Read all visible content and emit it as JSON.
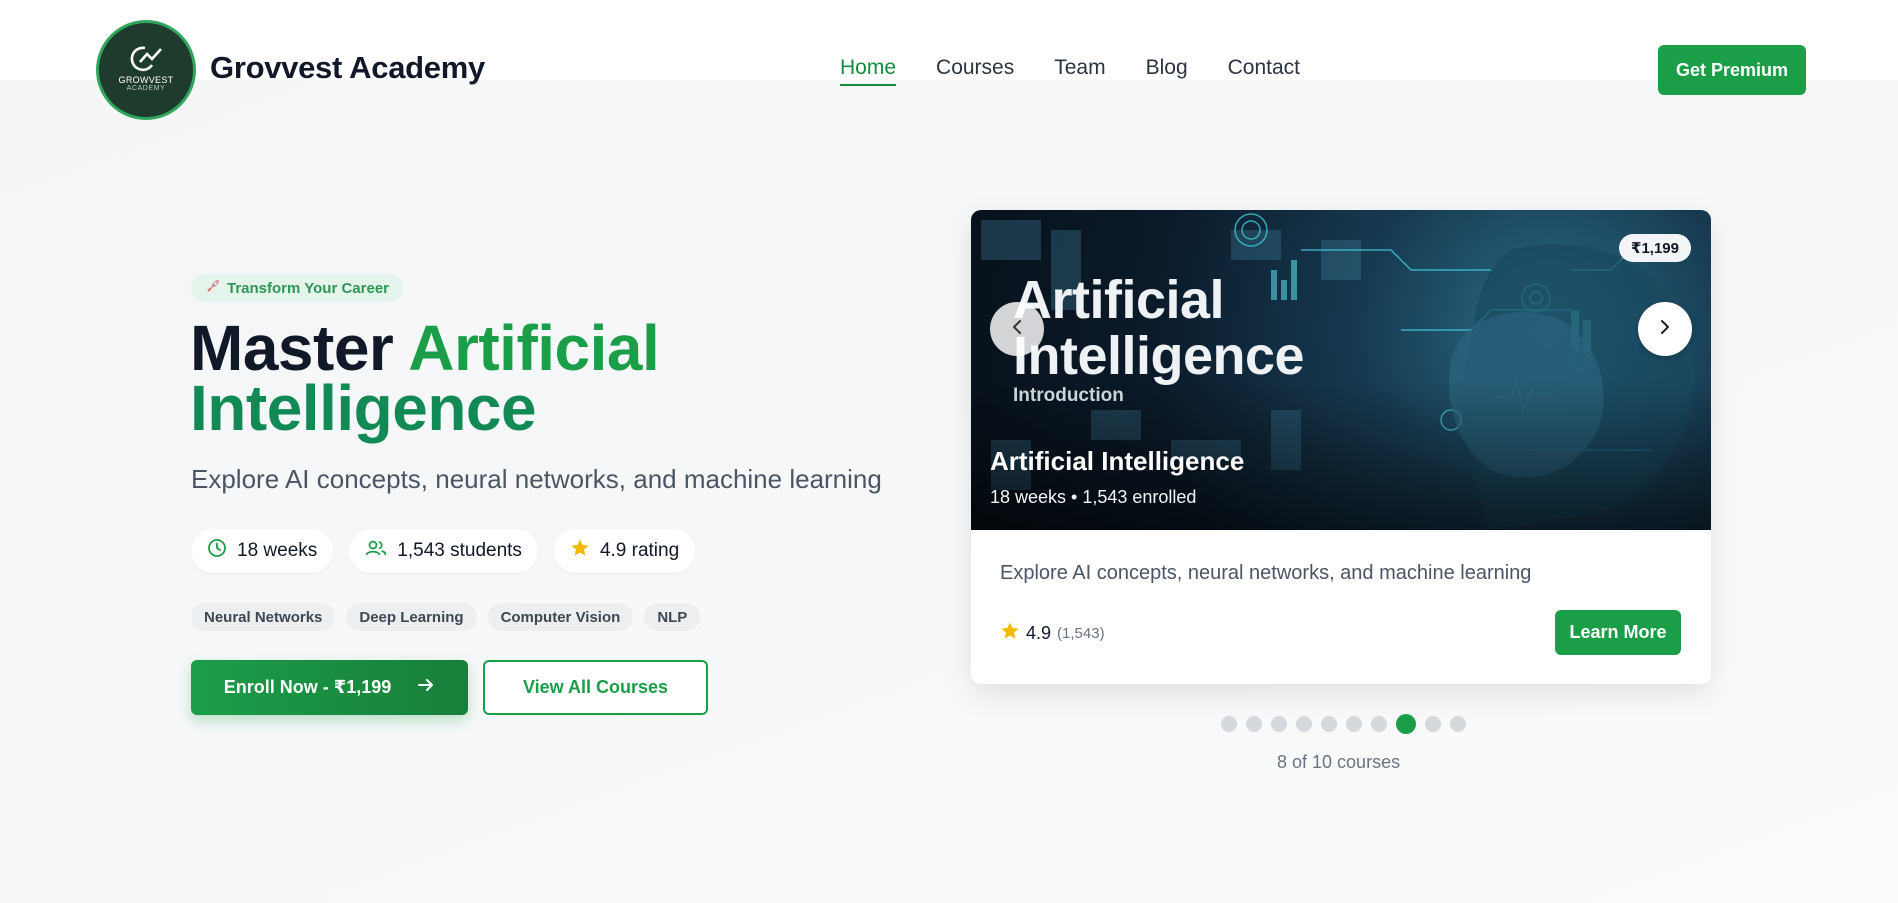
{
  "brand": {
    "name": "Grovvest Academy",
    "logo_text_line1": "GROWVEST",
    "logo_text_line2": "ACADEMY",
    "accent_color": "#1a9e48"
  },
  "nav": {
    "items": [
      {
        "label": "Home",
        "active": true
      },
      {
        "label": "Courses",
        "active": false
      },
      {
        "label": "Team",
        "active": false
      },
      {
        "label": "Blog",
        "active": false
      },
      {
        "label": "Contact",
        "active": false
      }
    ],
    "cta_label": "Get Premium"
  },
  "hero": {
    "tag_icon": "rocket-icon",
    "tag": "Transform Your Career",
    "headline_part1": "Master ",
    "headline_part2": "Artificial",
    "headline_part3": "Intelligence",
    "subtitle": "Explore AI concepts, neural networks, and machine learning",
    "stats": [
      {
        "icon": "clock-icon",
        "label": "18 weeks"
      },
      {
        "icon": "users-icon",
        "label": "1,543 students"
      },
      {
        "icon": "star-icon",
        "label": "4.9 rating"
      }
    ],
    "topics": [
      "Neural Networks",
      "Deep Learning",
      "Computer Vision",
      "NLP"
    ],
    "enroll_label": "Enroll Now - ₹1,199",
    "view_all_label": "View All Courses"
  },
  "card": {
    "image_title_line1": "Artificial",
    "image_title_line2": "Intelligence",
    "image_subtitle": "Introduction",
    "price": "₹1,199",
    "title": "Artificial Intelligence",
    "meta": "18 weeks • 1,543 enrolled",
    "description": "Explore AI concepts, neural networks, and machine learning",
    "rating": "4.9",
    "rating_count": "(1,543)",
    "learn_more_label": "Learn More"
  },
  "carousel": {
    "total": 10,
    "active_index": 7,
    "counter": "8 of 10 courses"
  }
}
